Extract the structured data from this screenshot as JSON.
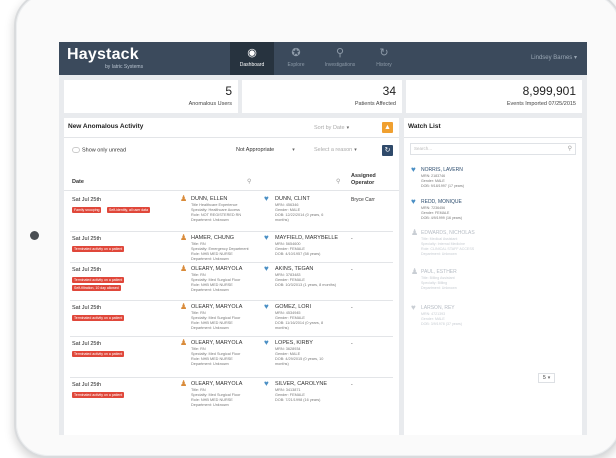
{
  "app": {
    "logo": "Haystack",
    "tagline": "by Iatric Systems",
    "user_menu": "Lindsey Barnes",
    "nav": [
      {
        "label": "Dashboard",
        "icon": "dashboard-icon",
        "glyph": "◉",
        "active": true
      },
      {
        "label": "Explore",
        "icon": "compass-icon",
        "glyph": "✪",
        "active": false
      },
      {
        "label": "Investigations",
        "icon": "search-icon",
        "glyph": "⚲",
        "active": false
      },
      {
        "label": "History",
        "icon": "history-icon",
        "glyph": "↻",
        "active": false
      }
    ]
  },
  "stats": [
    {
      "value": "5",
      "label": "Anomalous Users"
    },
    {
      "value": "34",
      "label": "Patients Affected"
    },
    {
      "value": "8,999,901",
      "label": "Events Imported 07/25/2015"
    }
  ],
  "activity": {
    "title": "New Anomalous Activity",
    "filter_top": "Sort by Date",
    "show_unread": "Show only unread",
    "filter_not_appropriate": "Not Appropriate",
    "filter_select": "Select a reason",
    "columns": {
      "date": "Date",
      "assigned": "Assigned\nOperator"
    },
    "rows": [
      {
        "date": "Sat Jul 25th",
        "tags": [
          "Family snooping",
          "Self-identity, all user data"
        ],
        "user": "DUNN, ELLEN",
        "user_det": "Title Healthcare Experience\nSpecialty: Healthcare Access\nRole: NOT REGISTERED RN\nDepartment: Unknown",
        "patient": "DUNN, CLINT",
        "patient_det": "MRN: 456346\nGender: MALE\nDOB: 12/22/2014 (0 years, 6\nmonths)",
        "operator": "Bryce Carr"
      },
      {
        "date": "Sat Jul 25th",
        "tags": [
          "Terminated activity on a patient"
        ],
        "user": "HAMER, CHUNG",
        "user_det": "Title: RN\nSpecialty: Emergency Department\nRole: NHB MED NURSE\nDepartment: Unknown",
        "patient": "MAYFIELD, MARYBELLE",
        "patient_det": "MRN: 5654600\nGender: FEMALE\nDOB: 4/10/1957 (58 years)",
        "operator": "-"
      },
      {
        "date": "Sat Jul 25th",
        "tags": [
          "Terminated activity on a patient",
          "Self-filtration, 10 day allowed"
        ],
        "user": "OLEARY, MARYOLA",
        "user_det": "Title: RN\nSpecialty: Med Surgical Floor\nRole: NHB MED NURSE\nDepartment: Unknown",
        "patient": "AKINS, TEGAN",
        "patient_det": "MRN: 3783483\nGender: FEMALE\nDOB: 10/3/2013 (1 years, 8 months)",
        "operator": "-"
      },
      {
        "date": "Sat Jul 25th",
        "tags": [
          "Terminated activity on a patient"
        ],
        "user": "OLEARY, MARYOLA",
        "user_det": "Title: RN\nSpecialty: Med Surgical Floor\nRole: NHB MED NURSE\nDepartment: Unknown",
        "patient": "GOMEZ, LORI",
        "patient_det": "MRN: 4534945\nGender: FEMALE\nDOB: 11/16/2014 (0 years, 8\nmonths)",
        "operator": "-"
      },
      {
        "date": "Sat Jul 25th",
        "tags": [
          "Terminated activity on a patient"
        ],
        "user": "OLEARY, MARYOLA",
        "user_det": "Title: RN\nSpecialty: Med Surgical Floor\nRole: NHB MED NURSE\nDepartment: Unknown",
        "patient": "LOPES, KIRBY",
        "patient_det": "MRN: 3628934\nGender: MALE\nDOB: 4/29/2015 (0 years, 10\nmonths)",
        "operator": "-"
      },
      {
        "date": "Sat Jul 25th",
        "tags": [
          "Terminated activity on a patient"
        ],
        "user": "OLEARY, MARYOLA",
        "user_det": "Title: RN\nSpecialty: Med Surgical Floor\nRole: NHB MED NURSE\nDepartment: Unknown",
        "patient": "SILVER, CAROLYNE",
        "patient_det": "MRN: 3413871\nGender: FEMALE\nDOB: 7/21/1998 (16 years)",
        "operator": "-"
      }
    ]
  },
  "watch": {
    "title": "Watch List",
    "search_placeholder": "Search...",
    "items": [
      {
        "name": "NORRIS, LAVERN",
        "det": "MRN: 2183746\nGender: MALE\nDOB: 9/18/1997 (17 years)",
        "faint": false,
        "kind": "patient"
      },
      {
        "name": "REDD, MONIQUE",
        "det": "MRN: 7236456\nGender: FEMALE\nDOB: 4/9/1999 (16 years)",
        "faint": false,
        "kind": "patient"
      },
      {
        "name": "EDWARDS, NICHOLAS",
        "det": "Title: Medical Assistant\nSpecialty: Internal Medicine\nRole: CLINICAL STAFF ACCESS\nDepartment: Unknown",
        "faint": true,
        "kind": "user"
      },
      {
        "name": "PAUL, ESTHER",
        "det": "Title: Billing Assistant\nSpecialty: Billing\nDepartment: Unknown",
        "faint": true,
        "kind": "user"
      },
      {
        "name": "LARSON, REY",
        "det": "MRN: 4721393\nGender: MALE\nDOB: 3/9/1978 (37 years)",
        "faint": true,
        "kind": "patient"
      }
    ],
    "page_size": "5"
  },
  "colors": {
    "header": "#3b4a5c",
    "accent_orange": "#f0a030",
    "accent_navy": "#2f4a6a",
    "tag_red": "#e0473a",
    "user_icon": "#d98b3a",
    "patient_icon": "#4a8fc4"
  }
}
